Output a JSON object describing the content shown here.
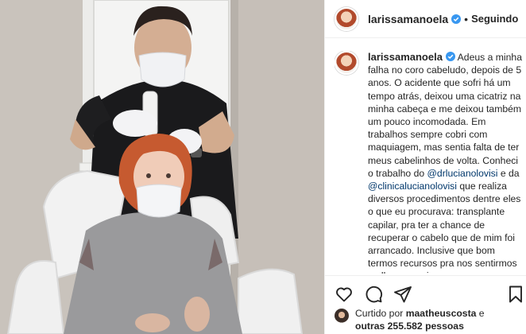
{
  "header": {
    "username": "larissamanoela",
    "dot": "•",
    "follow_status": "Seguindo"
  },
  "caption": {
    "username": "larissamanoela",
    "text_1": "Adeus a minha falha no coro cabeludo, depois de 5 anos. O acidente que sofri há um tempo atrás, deixou uma cicatriz na minha cabeça e me deixou também um pouco incomodada. Em trabalhos sempre cobri com maquiagem, mas sentia falta de ter meus cabelinhos de volta. Conheci o trabalho do ",
    "mention_1": "@drlucianolovisi",
    "text_2": " e da ",
    "mention_2": "@clinicalucianolovisi",
    "text_3": " que realiza diversos procedimentos dentre eles o que eu procurava: transplante capilar, pra ter a chance de recuperar o cabelo que de mim foi arrancado. Inclusive que bom termos recursos pra nos sentirmos melhores, mais seguros e com a autoestima elevada. E hoje iniciamos o processo! Logo"
  },
  "actions": {
    "like_icon": "heart-icon",
    "comment_icon": "comment-icon",
    "share_icon": "share-icon",
    "save_icon": "bookmark-icon"
  },
  "likes": {
    "prefix": "Curtido por ",
    "user": "maatheuscosta",
    "middle": " e",
    "others": "outras 255.582 pessoas"
  },
  "colors": {
    "verified": "#3897f0",
    "mention": "#00376b",
    "text": "#262626"
  }
}
